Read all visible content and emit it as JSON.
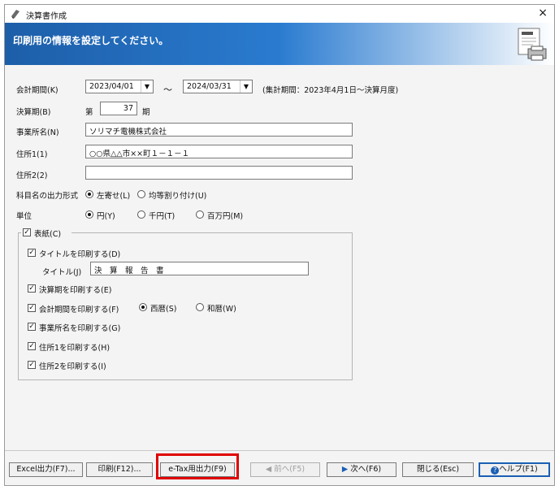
{
  "window": {
    "title": "決算書作成",
    "close": "×"
  },
  "banner": {
    "text": "印刷用の情報を設定してください。"
  },
  "fields": {
    "period_label": "会計期間(K)",
    "period_start": "2023/04/01",
    "period_tilde": "～",
    "period_end": "2024/03/31",
    "period_note": "(集計期間：2023年4月1日～決算月度)",
    "term_label": "決算期(B)",
    "term_prefix": "第",
    "term_value": "37",
    "term_suffix": "期",
    "company_label": "事業所名(N)",
    "company_value": "ソリマチ電機株式会社",
    "address1_label": "住所1(1)",
    "address1_value": "○○県△△市××町１－１－１",
    "address2_label": "住所2(2)",
    "address2_value": "",
    "account_format_label": "科目名の出力形式",
    "account_format_left": "左寄せ(L)",
    "account_format_even": "均等割り付け(U)",
    "unit_label": "単位",
    "unit_yen": "円(Y)",
    "unit_thousand": "千円(T)",
    "unit_million": "百万円(M)"
  },
  "cover": {
    "label": "表紙(C)",
    "print_title": "タイトルを印刷する(D)",
    "title_label": "タイトル(J)",
    "title_value": "決　算　報　告　書",
    "print_term": "決算期を印刷する(E)",
    "print_period": "会計期間を印刷する(F)",
    "era_western": "西暦(S)",
    "era_japanese": "和暦(W)",
    "print_company": "事業所名を印刷する(G)",
    "print_address1": "住所1を印刷する(H)",
    "print_address2": "住所2を印刷する(I)",
    "check_mark": "✓"
  },
  "buttons": {
    "excel": "Excel出力(F7)...",
    "print": "印刷(F12)...",
    "etax": "e-Tax用出力(F9)",
    "prev": "前へ(F5)",
    "next": "次へ(F6)",
    "close": "閉じる(Esc)",
    "help": "ヘルプ(F1)"
  }
}
